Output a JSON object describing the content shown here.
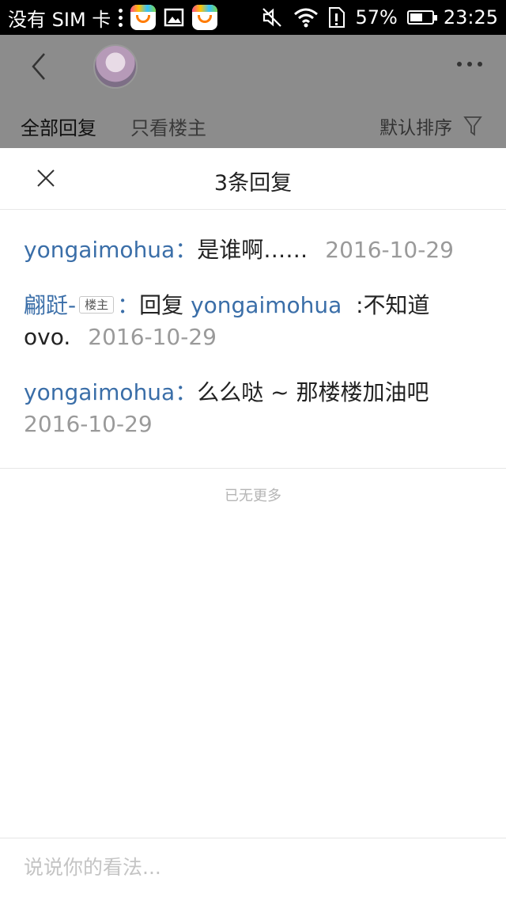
{
  "status_bar": {
    "carrier": "没有 SIM 卡",
    "battery": "57%",
    "battery_level": 0.57,
    "time": "23:25"
  },
  "header": {
    "tabs": [
      "全部回复",
      "只看楼主"
    ],
    "sort_label": "默认排序"
  },
  "panel": {
    "title": "3条回复",
    "replies": [
      {
        "user": "yongaimohua",
        "separator": "：",
        "text": "是谁啊……",
        "date": "2016-10-29"
      },
      {
        "user": "翩跹-",
        "badge": "楼主",
        "separator": "：",
        "reply_prefix": "回复",
        "mention": "yongaimohua",
        "text": ":不知道ovo.",
        "date": "2016-10-29"
      },
      {
        "user": "yongaimohua",
        "separator": "：",
        "text": "么么哒 ~ 那楼楼加油吧",
        "date": "2016-10-29"
      }
    ],
    "no_more": "已无更多"
  },
  "comment_bar": {
    "placeholder": "说说你的看法..."
  },
  "colors": {
    "link": "#3a6ea8",
    "date": "#9a9a9a",
    "overlay": "#8c8c8c"
  }
}
